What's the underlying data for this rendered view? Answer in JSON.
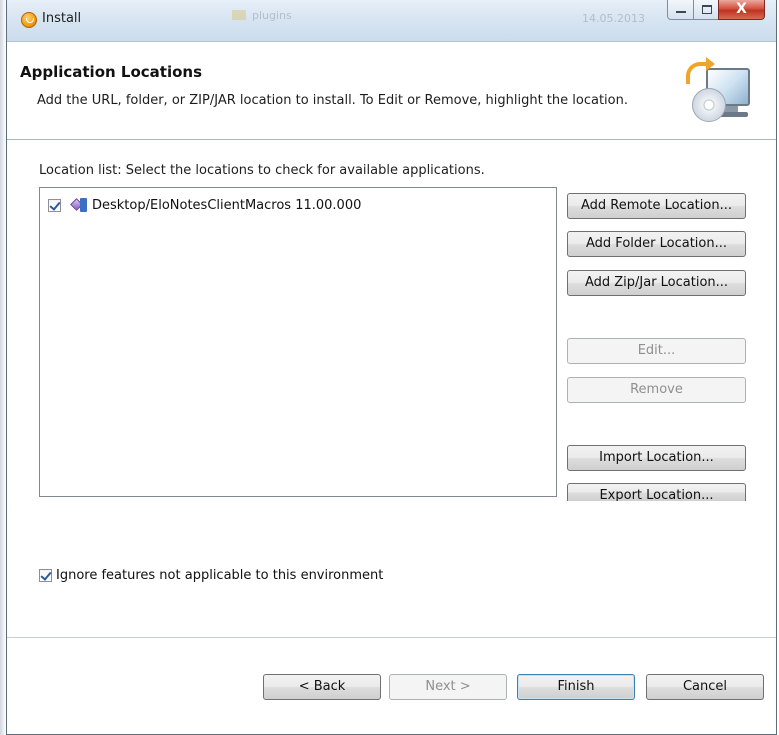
{
  "window": {
    "title": "Install",
    "background_title_text": "plugins",
    "background_date_text": "14.05.2013"
  },
  "banner": {
    "title": "Application Locations",
    "description": "Add the URL, folder, or ZIP/JAR location to install. To Edit or Remove, highlight the location."
  },
  "location_list": {
    "label": "Location list: Select the locations to check for available applications.",
    "items": [
      {
        "checked": true,
        "text": "Desktop/EloNotesClientMacros 11.00.000",
        "icon": "update-site-icon"
      }
    ]
  },
  "side_buttons": {
    "add_remote": "Add Remote Location...",
    "add_folder": "Add Folder Location...",
    "add_zip_jar": "Add Zip/Jar Location...",
    "edit": "Edit...",
    "remove": "Remove",
    "import": "Import Location...",
    "export": "Export Location..."
  },
  "options": {
    "ignore_label": "Ignore features not applicable to this environment",
    "ignore_checked": true
  },
  "footer": {
    "back": "< Back",
    "next": "Next >",
    "finish": "Finish",
    "cancel": "Cancel"
  },
  "window_controls": {
    "close_glyph": "X"
  },
  "colors": {
    "titlebar": "#d8e5f2",
    "close_button": "#c0321f",
    "default_button_border": "#3c7fb1",
    "disabled_text": "#8f8f8f"
  }
}
